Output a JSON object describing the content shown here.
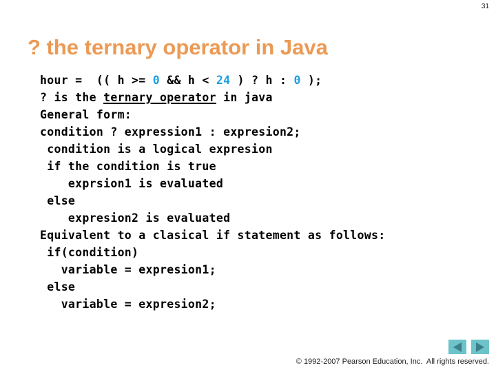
{
  "slide": {
    "number": "31",
    "title": "? the ternary operator in Java",
    "title_color": "#eb9a55",
    "literal_color": "#209fe0",
    "background_color": "#ffffff"
  },
  "code": {
    "lines": [
      {
        "id": "line-1",
        "segments": [
          {
            "text": "hour =  (( h >= ",
            "style": "plain"
          },
          {
            "text": "0",
            "style": "literal"
          },
          {
            "text": " && h < ",
            "style": "plain"
          },
          {
            "text": "24",
            "style": "literal"
          },
          {
            "text": " ) ? h : ",
            "style": "plain"
          },
          {
            "text": "0",
            "style": "literal"
          },
          {
            "text": " );",
            "style": "plain"
          }
        ]
      },
      {
        "id": "line-2",
        "segments": [
          {
            "text": "? is the ",
            "style": "plain"
          },
          {
            "text": "ternary operator",
            "style": "underline"
          },
          {
            "text": " in java",
            "style": "plain"
          }
        ]
      },
      {
        "id": "line-3",
        "segments": [
          {
            "text": "General form:",
            "style": "plain"
          }
        ]
      },
      {
        "id": "line-4",
        "segments": [
          {
            "text": "condition ? expression1 : expresion2;",
            "style": "plain"
          }
        ]
      },
      {
        "id": "line-5",
        "segments": [
          {
            "text": " condition is a logical expresion",
            "style": "plain"
          }
        ]
      },
      {
        "id": "line-6",
        "segments": [
          {
            "text": " if the condition is true",
            "style": "plain"
          }
        ]
      },
      {
        "id": "line-7",
        "segments": [
          {
            "text": "    exprsion1 is evaluated",
            "style": "plain"
          }
        ]
      },
      {
        "id": "line-8",
        "segments": [
          {
            "text": " else",
            "style": "plain"
          }
        ]
      },
      {
        "id": "line-9",
        "segments": [
          {
            "text": "    expresion2 is evaluated",
            "style": "plain"
          }
        ]
      },
      {
        "id": "line-10",
        "segments": [
          {
            "text": "Equivalent to a clasical if statement as follows:",
            "style": "plain"
          }
        ]
      },
      {
        "id": "line-11",
        "segments": [
          {
            "text": " if(condition)",
            "style": "plain"
          }
        ]
      },
      {
        "id": "line-12",
        "segments": [
          {
            "text": "   variable = expresion1;",
            "style": "plain"
          }
        ]
      },
      {
        "id": "line-13",
        "segments": [
          {
            "text": " else",
            "style": "plain"
          }
        ]
      },
      {
        "id": "line-14",
        "segments": [
          {
            "text": "   variable = expresion2;",
            "style": "plain"
          }
        ]
      }
    ]
  },
  "navigation": {
    "previous_icon": "left-triangle-icon",
    "next_icon": "right-triangle-icon",
    "button_color": "#6cc3c9",
    "arrow_color": "#3d7f88"
  },
  "footer": {
    "copyright": "© 1992-2007 Pearson Education, Inc.  All rights reserved."
  }
}
